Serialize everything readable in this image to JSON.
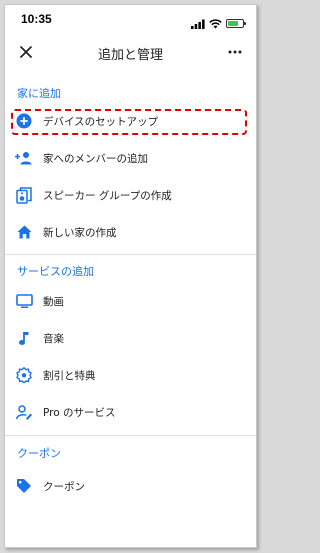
{
  "status_bar": {
    "time": "10:35"
  },
  "header": {
    "title": "追加と管理"
  },
  "sections": {
    "home": {
      "title": "家に追加",
      "items": [
        {
          "label": "デバイスのセットアップ",
          "icon": "add-circle-icon"
        },
        {
          "label": "家へのメンバーの追加",
          "icon": "person-add-icon"
        },
        {
          "label": "スピーカー グループの作成",
          "icon": "speaker-group-icon"
        },
        {
          "label": "新しい家の作成",
          "icon": "home-icon"
        }
      ]
    },
    "services": {
      "title": "サービスの追加",
      "items": [
        {
          "label": "動画",
          "icon": "tv-icon"
        },
        {
          "label": "音楽",
          "icon": "music-note-icon"
        },
        {
          "label": "割引と特典",
          "icon": "discount-badge-icon"
        },
        {
          "label": "Pro のサービス",
          "icon": "pro-service-icon"
        }
      ]
    },
    "coupons": {
      "title": "クーポン",
      "items": [
        {
          "label": "クーポン",
          "icon": "tag-icon"
        }
      ]
    }
  },
  "colors": {
    "accent": "#1a73e8",
    "highlight": "#e00000",
    "battery": "#34c759"
  }
}
